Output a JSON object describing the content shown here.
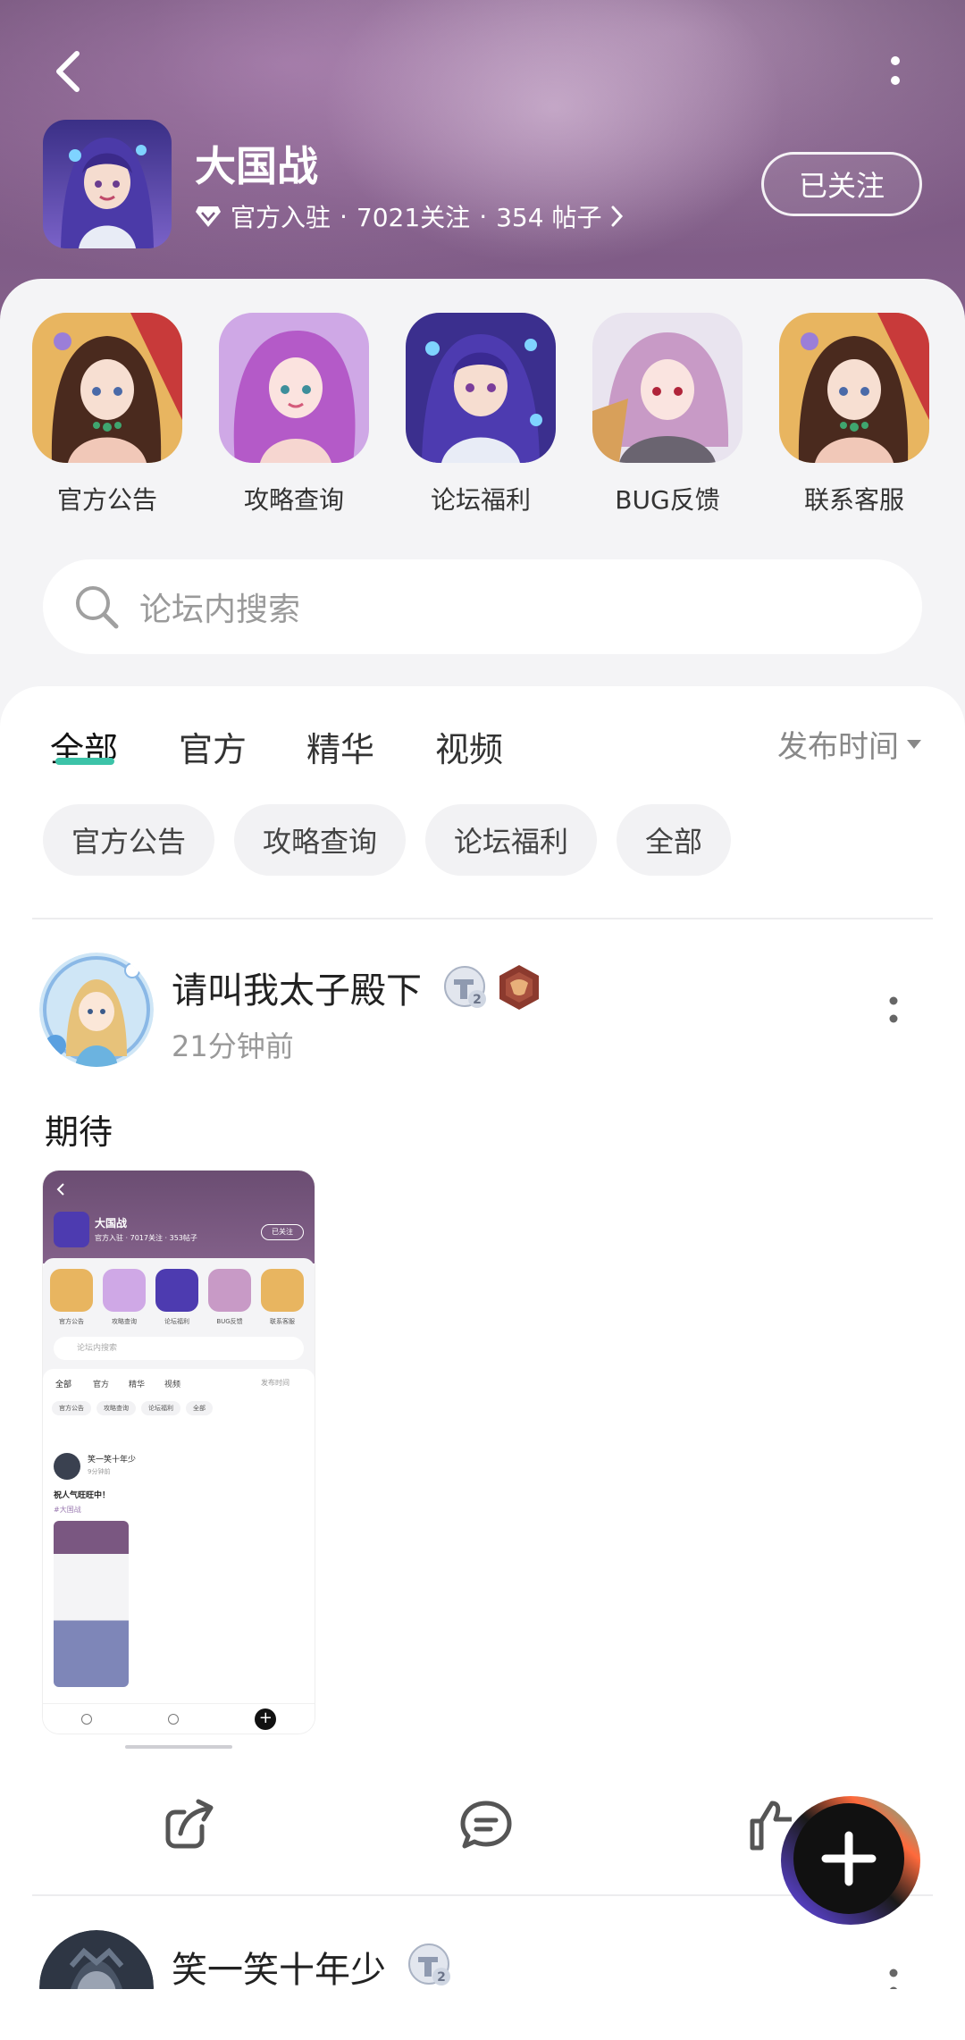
{
  "header": {
    "title": "大国战",
    "meta_badge": "官方入驻",
    "followers": "7021关注",
    "posts": "354 帖子",
    "follow_label": "已关注"
  },
  "shortcuts": [
    {
      "label": "官方公告"
    },
    {
      "label": "攻略查询"
    },
    {
      "label": "论坛福利"
    },
    {
      "label": "BUG反馈"
    },
    {
      "label": "联系客服"
    }
  ],
  "search": {
    "placeholder": "论坛内搜索"
  },
  "tabs": [
    {
      "label": "全部",
      "active": true
    },
    {
      "label": "官方"
    },
    {
      "label": "精华"
    },
    {
      "label": "视频"
    }
  ],
  "sort": {
    "label": "发布时间"
  },
  "chips": [
    {
      "label": "官方公告"
    },
    {
      "label": "攻略查询"
    },
    {
      "label": "论坛福利"
    },
    {
      "label": "全部"
    }
  ],
  "posts": [
    {
      "user": "请叫我太子殿下",
      "level": "2",
      "time": "21分钟前",
      "text": "期待",
      "screenshot": {
        "title": "大国战",
        "meta": "官方入驻 · 7017关注 · 353帖子",
        "follow": "已关注",
        "shortcut_labels": [
          "官方公告",
          "攻略查询",
          "论坛福利",
          "BUG反馈",
          "联系客服"
        ],
        "search": "论坛内搜索",
        "tabs": [
          "全部",
          "官方",
          "精华",
          "视频"
        ],
        "sort": "发布时间",
        "chips": [
          "官方公告",
          "攻略查询",
          "论坛福利",
          "全部"
        ],
        "user": "笑一笑十年少",
        "time": "9分钟前",
        "text": "祝人气旺旺中！",
        "tag": "#大国战"
      }
    },
    {
      "user": "笑一笑十年少",
      "level": "2"
    }
  ],
  "colors": {
    "accent": "#3cc3a8",
    "header": "#7a5781"
  }
}
